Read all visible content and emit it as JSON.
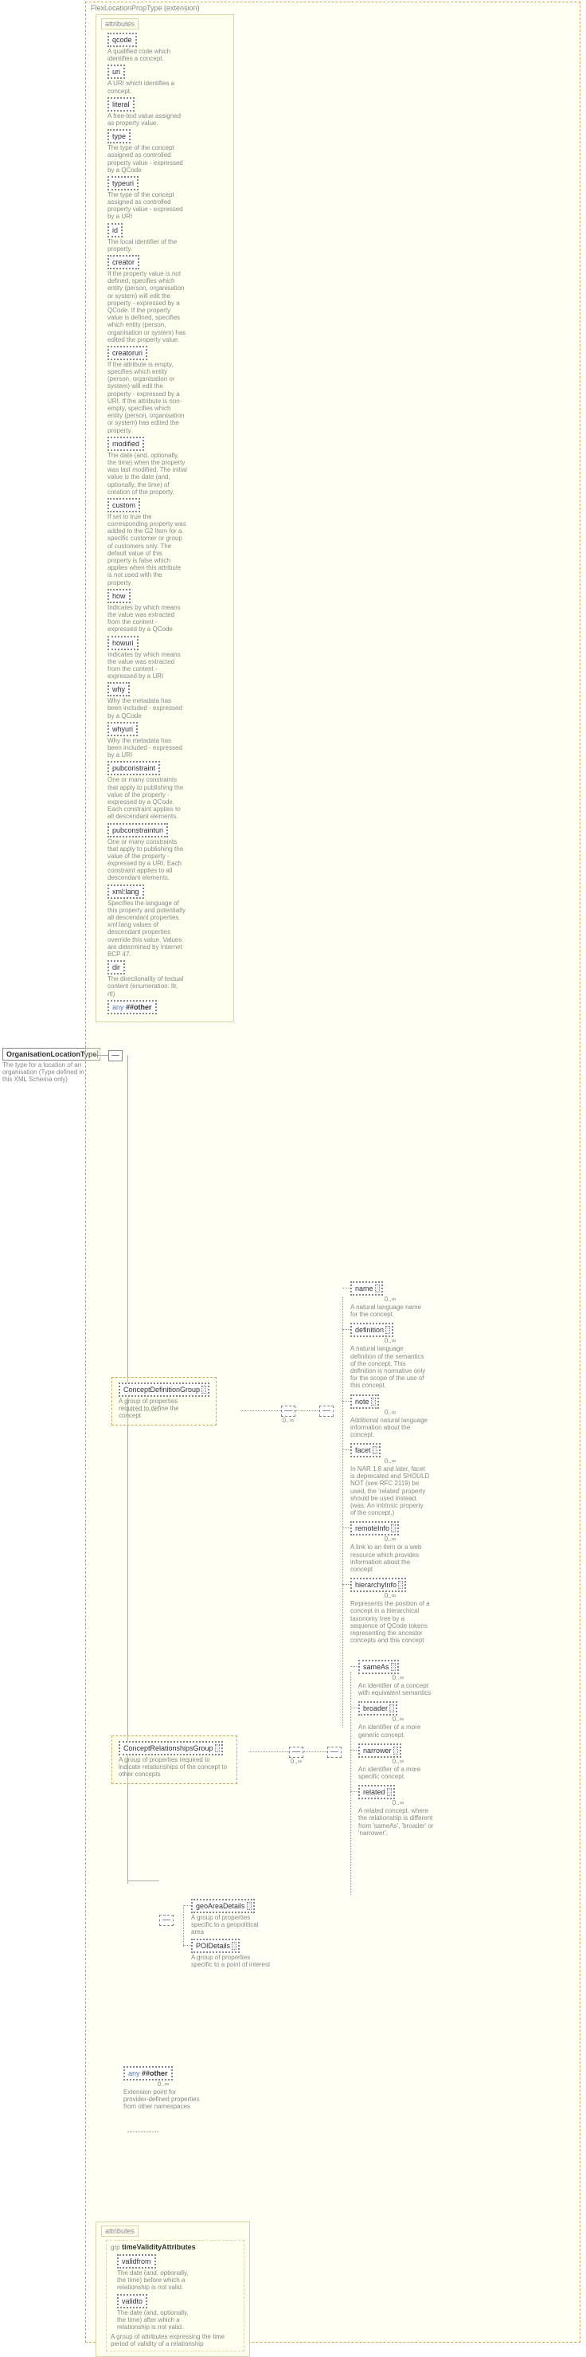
{
  "root": {
    "name": "OrganisationLocationType",
    "desc": "The type for a location of an organisation (Type defined in this XML Schema only)"
  },
  "extension": {
    "label": "FlexLocationPropType (extension)"
  },
  "attributes_header": "attributes",
  "attributes": [
    {
      "name": "qcode",
      "desc": "A qualified code which identifies a concept."
    },
    {
      "name": "uri",
      "desc": "A URI which identifies a concept."
    },
    {
      "name": "literal",
      "desc": "A free-text value assigned as property value."
    },
    {
      "name": "type",
      "desc": "The type of the concept assigned as controlled property value - expressed by a QCode"
    },
    {
      "name": "typeuri",
      "desc": "The type of the concept assigned as controlled property value - expressed by a URI"
    },
    {
      "name": "id",
      "desc": "The local identifier of the property."
    },
    {
      "name": "creator",
      "desc": "If the property value is not defined, specifies which entity (person, organisation or system) will edit the property - expressed by a QCode. If the property value is defined, specifies which entity (person, organisation or system) has edited the property value."
    },
    {
      "name": "creatoruri",
      "desc": "If the attribute is empty, specifies which entity (person, organisation or system) will edit the property - expressed by a URI. If the attribute is non-empty, specifies which entity (person, organisation or system) has edited the property."
    },
    {
      "name": "modified",
      "desc": "The date (and, optionally, the time) when the property was last modified. The initial value is the date (and, optionally, the time) of creation of the property."
    },
    {
      "name": "custom",
      "desc": "If set to true the corresponding property was added to the G2 Item for a specific customer or group of customers only. The default value of this property is false which applies when this attribute is not used with the property."
    },
    {
      "name": "how",
      "desc": "Indicates by which means the value was extracted from the content - expressed by a QCode"
    },
    {
      "name": "howuri",
      "desc": "Indicates by which means the value was extracted from the content - expressed by a URI"
    },
    {
      "name": "why",
      "desc": "Why the metadata has been included - expressed by a QCode"
    },
    {
      "name": "whyuri",
      "desc": "Why the metadata has been included - expressed by a URI"
    },
    {
      "name": "pubconstraint",
      "desc": "One or many constraints that apply to publishing the value of the property - expressed by a QCode. Each constraint applies to all descendant elements."
    },
    {
      "name": "pubconstrainturi",
      "desc": "One or many constraints that apply to publishing the value of the property - expressed by a URI. Each constraint applies to all descendant elements."
    },
    {
      "name": "xml:lang",
      "desc": "Specifies the language of this property and potentially all descendant properties. xml:lang values of descendant properties override this value. Values are determined by Internet BCP 47."
    },
    {
      "name": "dir",
      "desc": "The directionality of textual content (enumeration: ltr, rtl)"
    }
  ],
  "any_other": "##other",
  "any_label": "any",
  "conceptDef": {
    "name": "ConceptDefinitionGroup",
    "desc": "A group of properties required to define the concept",
    "children": [
      {
        "name": "name",
        "desc": "A natural language name for the concept."
      },
      {
        "name": "definition",
        "desc": "A natural language definition of the semantics of the concept. This definition is normative only for the scope of the use of this concept."
      },
      {
        "name": "note",
        "desc": "Additional natural language information about the concept."
      },
      {
        "name": "facet",
        "desc": "In NAR 1.8 and later, facet is deprecated and SHOULD NOT (see RFC 2119) be used, the 'related' property should be used instead. (was: An intrinsic property of the concept.)"
      },
      {
        "name": "remoteInfo",
        "desc": "A link to an item or a web resource which provides information about the concept"
      },
      {
        "name": "hierarchyInfo",
        "desc": "Represents the position of a concept in a hierarchical taxonomy tree by a sequence of QCode tokens representing the ancestor concepts and this concept"
      }
    ]
  },
  "conceptRel": {
    "name": "ConceptRelationshipsGroup",
    "desc": "A group of properties required to indicate relationships of the concept to other concepts",
    "children": [
      {
        "name": "sameAs",
        "desc": "An identifier of a concept with equivalent semantics"
      },
      {
        "name": "broader",
        "desc": "An identifier of a more generic concept."
      },
      {
        "name": "narrower",
        "desc": "An identifier of a more specific concept."
      },
      {
        "name": "related",
        "desc": "A related concept, where the relationship is different from 'sameAs', 'broader' or 'narrower'."
      }
    ]
  },
  "geo": {
    "name": "geoAreaDetails",
    "desc": "A group of properties specific to a geopolitical area"
  },
  "poi": {
    "name": "POIDetails",
    "desc": "A group of properties specific to a point of interest"
  },
  "anyblock": {
    "label": "##other",
    "desc": "Extension point for provider-defined properties from other namespaces"
  },
  "occurs": "0..∞",
  "timeValidity": {
    "group": "timeValidityAttributes",
    "group_label": "grp",
    "desc": "A group of attributes expressing the time period of validity of a relationship",
    "attrs": [
      {
        "name": "validfrom",
        "desc": "The date (and, optionally, the time) before which a relationship is not valid."
      },
      {
        "name": "validto",
        "desc": "The date (and, optionally, the time) after which a relationship is not valid."
      }
    ]
  }
}
